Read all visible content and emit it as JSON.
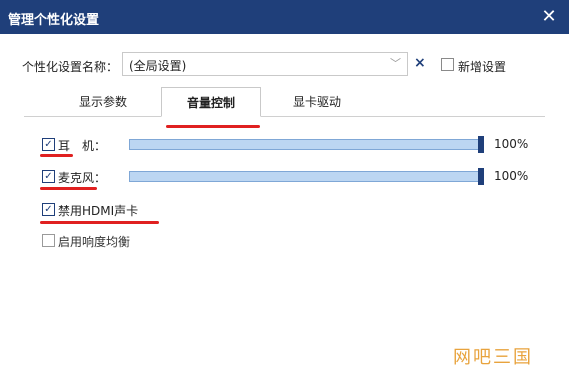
{
  "window": {
    "title": "管理个性化设置",
    "close_icon": "close-icon"
  },
  "profile": {
    "label": "个性化设置名称：",
    "selected": "(全局设置)",
    "clear_icon": "×",
    "new_label": "新增设置",
    "new_checked": false
  },
  "tabs": [
    {
      "label": "显示参数",
      "active": false
    },
    {
      "label": "音量控制",
      "active": true
    },
    {
      "label": "显卡驱动",
      "active": false
    }
  ],
  "volume": {
    "earphone": {
      "label": "耳　机：",
      "checked": true,
      "level_percent": 100,
      "value_text": "100%"
    },
    "microphone": {
      "label": "麦克风：",
      "checked": true,
      "level_percent": 100,
      "value_text": "100%"
    },
    "hdmi": {
      "label": "禁用HDMI声卡",
      "checked": true
    },
    "loudness": {
      "label": "启用响度均衡",
      "checked": false
    }
  },
  "watermark": "网吧三国",
  "colors": {
    "titlebar": "#1f3f7a",
    "accent": "#1f3f7a",
    "slider_fill": "#bcd6f2",
    "annotation_red": "#e02020",
    "watermark": "#e8a33d"
  }
}
